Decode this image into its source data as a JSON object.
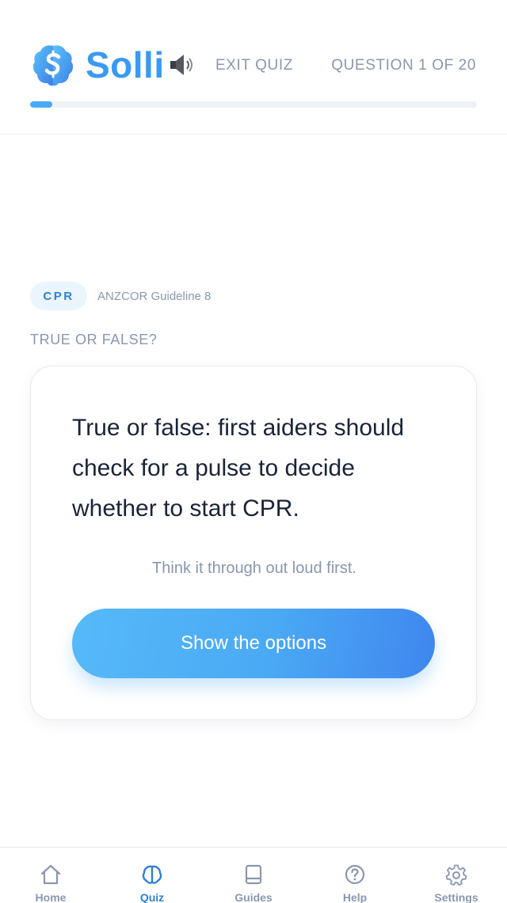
{
  "header": {
    "brand": "Solli",
    "exit_label": "EXIT QUIZ",
    "question_counter": "QUESTION 1 OF 20",
    "progress": 0.05
  },
  "question": {
    "tag": "CPR",
    "guideline": "ANZCOR Guideline 8",
    "type": "TRUE OR FALSE?",
    "text": "True or false: first aiders should check for a pulse to decide whether to start CPR.",
    "hint": "Think it through out loud first.",
    "cta_label": "Show the options"
  },
  "nav": {
    "items": [
      {
        "label": "Home",
        "icon": "home-icon",
        "active": false
      },
      {
        "label": "Quiz",
        "icon": "brain-icon",
        "active": true
      },
      {
        "label": "Guides",
        "icon": "book-icon",
        "active": false
      },
      {
        "label": "Help",
        "icon": "help-circle-icon",
        "active": false
      },
      {
        "label": "Settings",
        "icon": "gear-icon",
        "active": false
      }
    ]
  },
  "colors": {
    "accent": "#3a9af0",
    "text_primary": "#1b2338",
    "text_muted": "#8a97ad",
    "active_nav": "#2f7fcf"
  }
}
